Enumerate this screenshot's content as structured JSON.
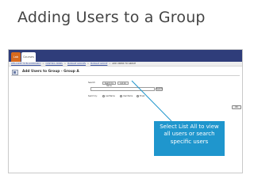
{
  "slide": {
    "title": "Adding Users to a Group"
  },
  "app": {
    "tabs": [
      "Lab",
      "Courses"
    ],
    "breadcrumbs": [
      "WELCOME TO BLACKBOARD!",
      "CONTROL PANEL",
      "MANAGE GROUPS",
      "MANAGE GROUP"
    ],
    "breadcrumb_current": "ADD USERS TO GROUP",
    "breadcrumb_separator": ">",
    "page_heading": "Add Users to Group - Group A",
    "search": {
      "label": "Search",
      "tabs": [
        "Search by Name",
        "List All"
      ],
      "input_value": "",
      "button_label": "Search",
      "search_by_label": "Search by:",
      "options": [
        "Last Name",
        "User Name",
        "Email"
      ]
    },
    "ok_label": "OK"
  },
  "callout": {
    "lines": [
      "Select List All to view",
      "all users or search",
      "specific users"
    ]
  },
  "colors": {
    "callout_bg": "#1f96cd",
    "topbar": "#2f3d7a",
    "active_tab": "#d86a1e",
    "title_text": "#444444"
  }
}
